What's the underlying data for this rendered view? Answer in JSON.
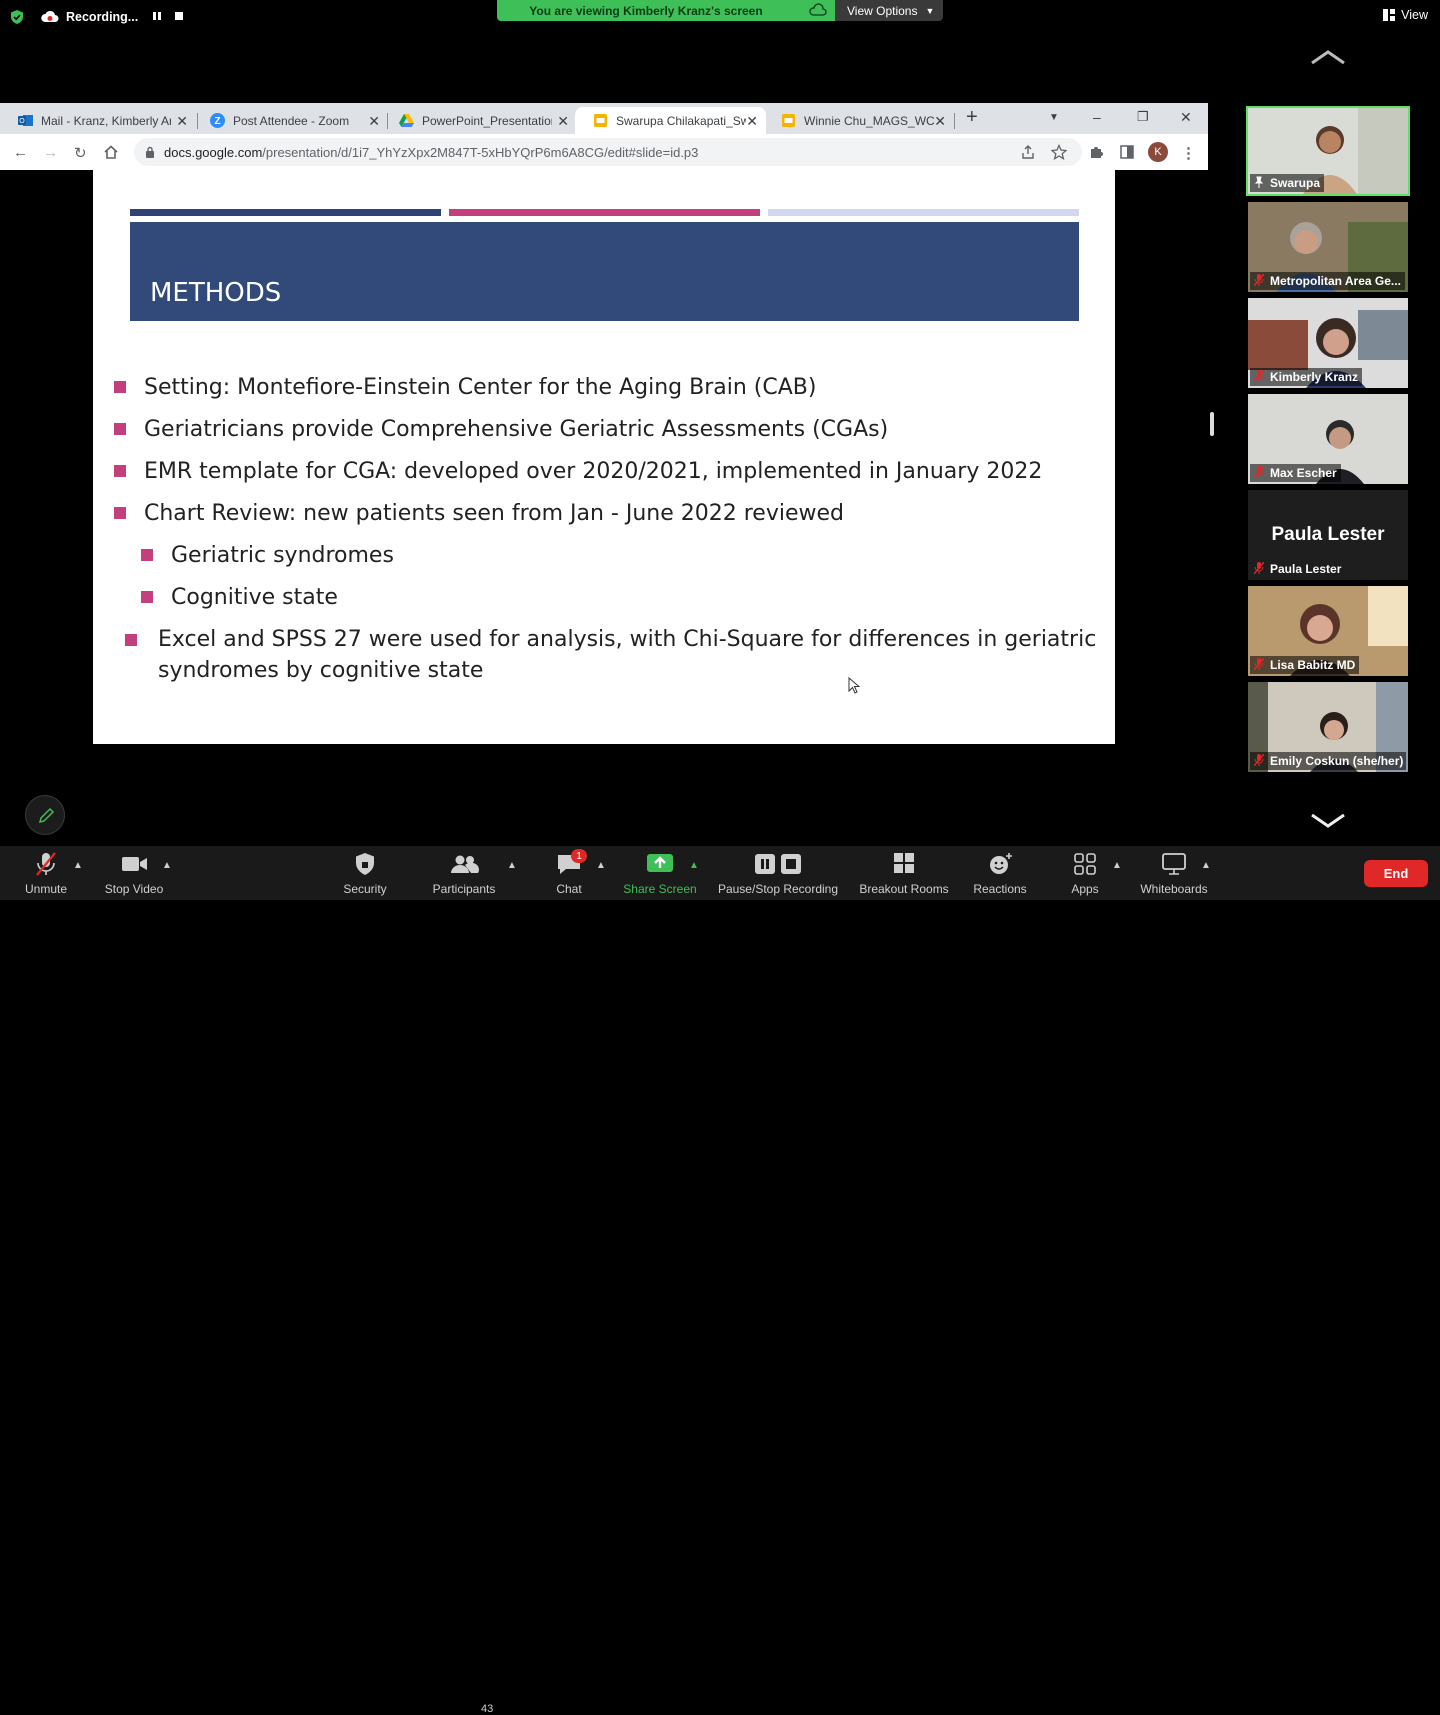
{
  "zoom": {
    "recording_label": "Recording...",
    "viewing_banner": "You are viewing Kimberly Kranz's screen",
    "view_options_label": "View Options",
    "view_label": "View"
  },
  "browser": {
    "tabs": [
      {
        "label": "Mail - Kranz, Kimberly An",
        "icon": "outlook-icon"
      },
      {
        "label": "Post Attendee - Zoom",
        "icon": "zoom-icon"
      },
      {
        "label": "PowerPoint_Presentation",
        "icon": "google-drive-icon"
      },
      {
        "label": "Swarupa Chilakapati_Swa",
        "icon": "google-slides-icon"
      },
      {
        "label": "Winnie Chu_MAGS_WC.p",
        "icon": "google-slides-icon"
      }
    ],
    "url_domain": "docs.google.com",
    "url_path": "/presentation/d/1i7_YhYzXpx2M847T-5xHbYQrP6m6A8CG/edit#slide=id.p3",
    "profile_initial": "K"
  },
  "slide": {
    "title": "METHODS",
    "bullets": [
      "Setting: Montefiore-Einstein Center for the Aging Brain (CAB)",
      "Geriatricians provide Comprehensive Geriatric Assessments (CGAs)",
      "EMR template for CGA: developed over 2020/2021, implemented in January 2022",
      "Chart Review: new patients seen from Jan - June 2022 reviewed"
    ],
    "sub_bullets": [
      "Geriatric syndromes",
      "Cognitive state"
    ],
    "last_bullet_line1": "Excel and SPSS 27 were used for analysis, with Chi-Square for differences in geriatric",
    "last_bullet_line2": "syndromes by cognitive state"
  },
  "participants": [
    {
      "name": "Swarupa",
      "active": true
    },
    {
      "name": "Metropolitan Area Ge..."
    },
    {
      "name": "Kimberly Kranz"
    },
    {
      "name": "Max Escher"
    },
    {
      "name": "Paula Lester",
      "video_off_name": "Paula Lester"
    },
    {
      "name": "Lisa Babitz MD"
    },
    {
      "name": "Emily Coskun (she/her)"
    }
  ],
  "toolbar": {
    "unmute": "Unmute",
    "stop_video": "Stop Video",
    "security": "Security",
    "participants": "Participants",
    "participant_count": "43",
    "chat": "Chat",
    "chat_badge": "1",
    "share_screen": "Share Screen",
    "pause_stop_recording": "Pause/Stop Recording",
    "breakout_rooms": "Breakout Rooms",
    "reactions": "Reactions",
    "apps": "Apps",
    "whiteboards": "Whiteboards",
    "end": "End"
  },
  "colors": {
    "share_green": "#3fbf58",
    "end_red": "#e02828",
    "slide_navy": "#324a7a",
    "slide_magenta": "#c43f7e"
  }
}
